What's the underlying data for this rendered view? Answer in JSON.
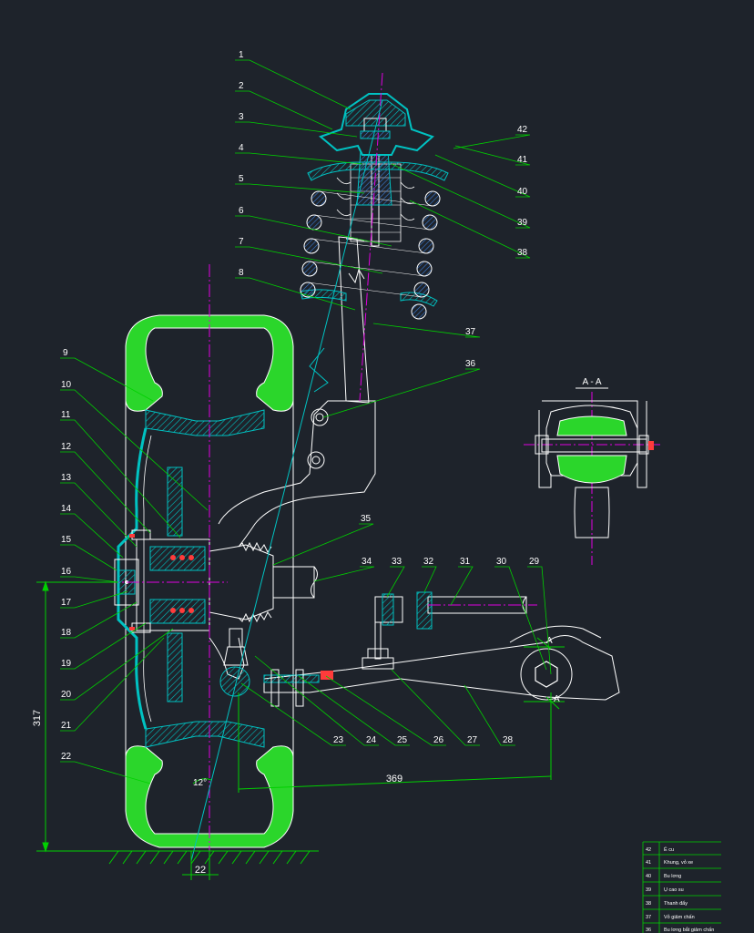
{
  "section_label": "A - A",
  "callouts": [
    "1",
    "2",
    "3",
    "4",
    "5",
    "6",
    "7",
    "8",
    "9",
    "10",
    "11",
    "12",
    "13",
    "14",
    "15",
    "16",
    "17",
    "18",
    "19",
    "20",
    "21",
    "22",
    "23",
    "24",
    "25",
    "26",
    "27",
    "28",
    "29",
    "30",
    "31",
    "32",
    "33",
    "34",
    "35",
    "36",
    "37",
    "38",
    "39",
    "40",
    "41",
    "42"
  ],
  "dimensions": {
    "height": "317",
    "span": "369",
    "offset": "22",
    "angle": "12°"
  },
  "parts_table": [
    {
      "no": "42",
      "name": "Ê cu"
    },
    {
      "no": "41",
      "name": "Khung, vỏ xe"
    },
    {
      "no": "40",
      "name": "Bu lơng"
    },
    {
      "no": "39",
      "name": "Ụ cao su"
    },
    {
      "no": "38",
      "name": "Thanh đẩy"
    },
    {
      "no": "37",
      "name": "Vỏ giảm chấn"
    },
    {
      "no": "36",
      "name": "Bu lơng bắt giảm chấn"
    }
  ],
  "colors": {
    "background": "#1e232b",
    "outline": "#ffffff",
    "section_fill": "#00c2c2",
    "tyre_fill": "#2bd62b",
    "leader": "#00d000",
    "centerline": "#e000e0",
    "dimension": "#00d000"
  }
}
